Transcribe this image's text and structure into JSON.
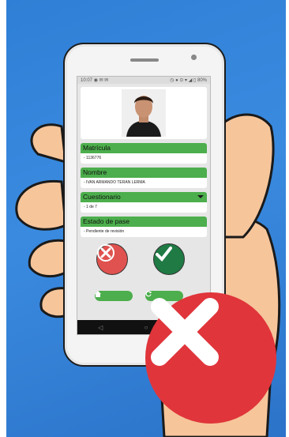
{
  "status_bar": {
    "time": "10:07",
    "icons_left": "◉ ✉ ✉",
    "icons_right": "◷ ● ⊙ ▾ ◢ ▯ 80%"
  },
  "fields": [
    {
      "label": "Matrícula",
      "value": "- 1136776"
    },
    {
      "label": "Nombre",
      "value": "- IVAN ARMANDO TERAN LERMA"
    },
    {
      "label": "Cuestionario",
      "value": "- 1 de 7"
    },
    {
      "label": "Estado de pase",
      "value": "- Pendiente de revisión"
    }
  ],
  "icons": {
    "reject": "close-icon",
    "approve": "check-icon",
    "home": "home-icon",
    "refresh": "refresh-icon",
    "back": "◁",
    "home_nav": "○",
    "overlay": "big-x-icon"
  },
  "colors": {
    "background": "#3a8be0",
    "field_header": "#4cae4c",
    "reject": "#e0524f",
    "approve": "#1f7a44",
    "overlay_x": "#e0353b"
  }
}
